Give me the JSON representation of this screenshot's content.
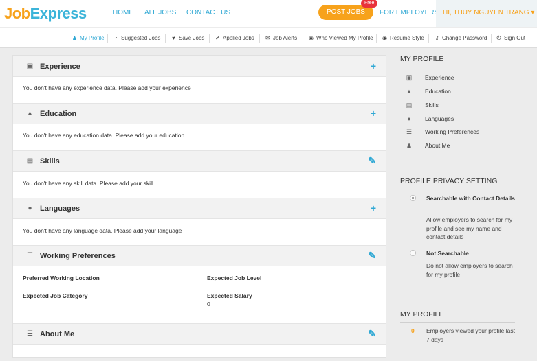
{
  "header": {
    "logo_part1": "Job",
    "logo_part2": "Express",
    "nav": [
      "HOME",
      "ALL JOBS",
      "CONTACT US"
    ],
    "post_jobs": "POST JOBS",
    "free_badge": "Free",
    "for_employers": "FOR EMPLOYERS",
    "user_greeting": "HI, THUY NGUYEN TRANG",
    "caret": "▾"
  },
  "subnav": [
    {
      "icon": "person-icon",
      "glyph": "♟",
      "label": "My Profile"
    },
    {
      "icon": "bell-icon",
      "glyph": "🔔",
      "label": "Suggested Jobs"
    },
    {
      "icon": "heart-icon",
      "glyph": "♥",
      "label": "Save Jobs"
    },
    {
      "icon": "check-icon",
      "glyph": "✔",
      "label": "Applied Jobs"
    },
    {
      "icon": "mail-icon",
      "glyph": "✉",
      "label": "Job Alerts"
    },
    {
      "icon": "eye-icon",
      "glyph": "◉",
      "label": "Who Viewed My Profile"
    },
    {
      "icon": "eye-icon",
      "glyph": "◉",
      "label": "Resume Style"
    },
    {
      "icon": "key-icon",
      "glyph": "⚷",
      "label": "Change Password"
    },
    {
      "icon": "power-icon",
      "glyph": "⏻",
      "label": "Sign Out"
    }
  ],
  "sections": [
    {
      "title": "Experience",
      "icon": "briefcase-icon",
      "glyph": "▣",
      "action": "+",
      "action_icon": "plus-icon",
      "body": "You don't have any experience data. Please add your experience"
    },
    {
      "title": "Education",
      "icon": "graduation-cap-icon",
      "glyph": "▲",
      "action": "+",
      "action_icon": "plus-icon",
      "body": "You don't have any education data. Please add your education"
    },
    {
      "title": "Skills",
      "icon": "tools-icon",
      "glyph": "▤",
      "action": "✎",
      "action_icon": "pencil-icon",
      "body": "You don't have any skill data. Please add your skill"
    },
    {
      "title": "Languages",
      "icon": "speech-bubble-icon",
      "glyph": "●",
      "action": "+",
      "action_icon": "plus-icon",
      "body": "You don't have any language data. Please add your language"
    },
    {
      "title": "Working Preferences",
      "icon": "list-icon",
      "glyph": "☰",
      "action": "✎",
      "action_icon": "pencil-icon"
    },
    {
      "title": "About Me",
      "icon": "list-icon",
      "glyph": "☰",
      "action": "✎",
      "action_icon": "pencil-icon"
    }
  ],
  "preferences": {
    "location_label": "Preferred Working Location",
    "level_label": "Expected Job Level",
    "category_label": "Expected Job Category",
    "salary_label": "Expected Salary",
    "salary_value": "0"
  },
  "sidebar": {
    "profile_title": "MY PROFILE",
    "menu": [
      {
        "label": "Experience",
        "icon": "briefcase-icon",
        "glyph": "▣"
      },
      {
        "label": "Education",
        "icon": "graduation-cap-icon",
        "glyph": "▲"
      },
      {
        "label": "Skills",
        "icon": "tools-icon",
        "glyph": "▤"
      },
      {
        "label": "Languages",
        "icon": "speech-bubble-icon",
        "glyph": "●"
      },
      {
        "label": "Working Preferences",
        "icon": "list-icon",
        "glyph": "☰"
      },
      {
        "label": "About Me",
        "icon": "person-icon",
        "glyph": "♟"
      }
    ],
    "privacy_title": "PROFILE PRIVACY SETTING",
    "privacy_options": [
      {
        "title": "Searchable with Contact Details",
        "desc": "Allow employers to search for my profile and see my name and contact details",
        "selected": true
      },
      {
        "title": "Not Searchable",
        "desc": "Do not allow employers to search for my profile",
        "selected": false
      }
    ],
    "stats_title": "MY PROFILE",
    "viewed_count": "0",
    "viewed_desc": "Employers viewed your profile last 7 days"
  },
  "colors": {
    "accent": "#2fa8d4",
    "brand_orange": "#f7a21b",
    "badge_red": "#e8323b"
  }
}
